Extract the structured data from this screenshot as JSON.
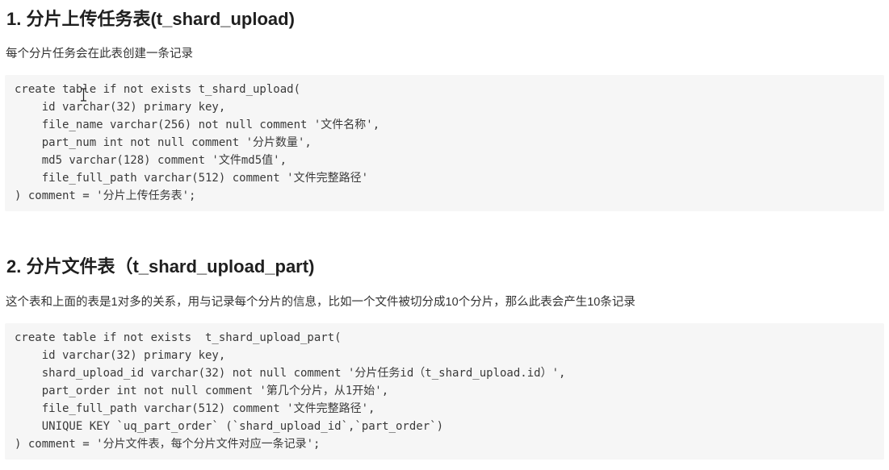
{
  "sections": [
    {
      "heading": "1. 分片上传任务表(t_shard_upload)",
      "description": "每个分片任务会在此表创建一条记录",
      "code_lines": [
        "create table if not exists t_shard_upload(",
        "    id varchar(32) primary key,",
        "    file_name varchar(256) not null comment '文件名称',",
        "    part_num int not null comment '分片数量',",
        "    md5 varchar(128) comment '文件md5值',",
        "    file_full_path varchar(512) comment '文件完整路径'",
        ") comment = '分片上传任务表';"
      ]
    },
    {
      "heading": "2. 分片文件表（t_shard_upload_part)",
      "description": "这个表和上面的表是1对多的关系，用与记录每个分片的信息，比如一个文件被切分成10个分片，那么此表会产生10条记录",
      "code_lines": [
        "create table if not exists  t_shard_upload_part(",
        "    id varchar(32) primary key,",
        "    shard_upload_id varchar(32) not null comment '分片任务id（t_shard_upload.id）',",
        "    part_order int not null comment '第几个分片，从1开始',",
        "    file_full_path varchar(512) comment '文件完整路径',",
        "    UNIQUE KEY `uq_part_order` (`shard_upload_id`,`part_order`)",
        ") comment = '分片文件表，每个分片文件对应一条记录';"
      ]
    }
  ],
  "colors": {
    "text": "#333333",
    "heading": "#1f1f1f",
    "code_background": "#f6f6f6"
  },
  "icons": {
    "mouse_cursor": "text-cursor-icon"
  }
}
